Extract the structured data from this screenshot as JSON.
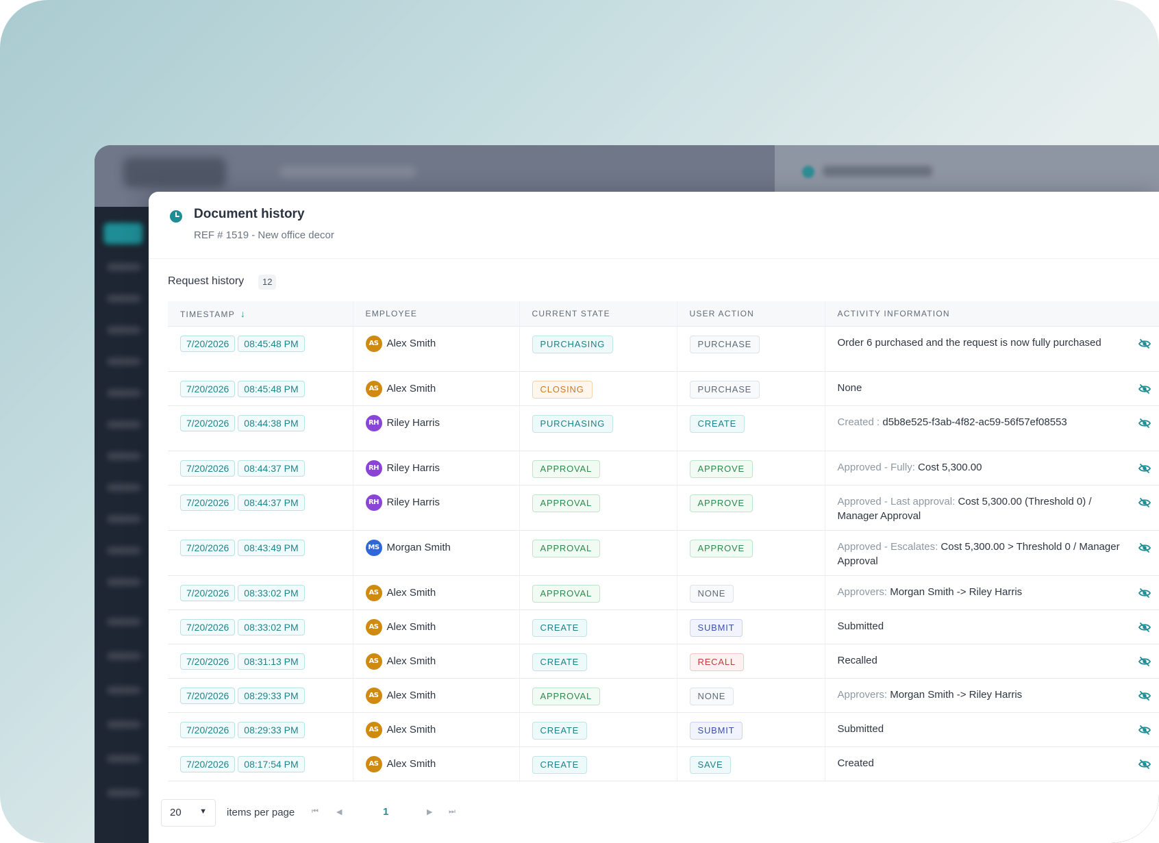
{
  "header": {
    "title": "Document history",
    "subtitle": "REF # 1519 - New office decor"
  },
  "section": {
    "title": "Request history",
    "count": "12"
  },
  "columns": [
    "TIMESTAMP",
    "EMPLOYEE",
    "CURRENT STATE",
    "USER ACTION",
    "ACTIVITY INFORMATION"
  ],
  "rows": [
    {
      "date": "7/20/2026",
      "time": "08:45:48 PM",
      "initials": "AS",
      "avatar_color": "#cf8a12",
      "employee": "Alex Smith",
      "state": "PURCHASING",
      "state_style": "teal",
      "action": "PURCHASE",
      "action_style": "gray",
      "info_muted": "",
      "info": "Order 6 purchased and the request is now fully purchased"
    },
    {
      "date": "7/20/2026",
      "time": "08:45:48 PM",
      "initials": "AS",
      "avatar_color": "#cf8a12",
      "employee": "Alex Smith",
      "state": "CLOSING",
      "state_style": "orange",
      "action": "PURCHASE",
      "action_style": "gray",
      "info_muted": "",
      "info": "None"
    },
    {
      "date": "7/20/2026",
      "time": "08:44:38 PM",
      "initials": "RH",
      "avatar_color": "#8a44d6",
      "employee": "Riley Harris",
      "state": "PURCHASING",
      "state_style": "teal",
      "action": "CREATE",
      "action_style": "teal",
      "info_muted": "Created : ",
      "info": "d5b8e525-f3ab-4f82-ac59-56f57ef08553"
    },
    {
      "date": "7/20/2026",
      "time": "08:44:37 PM",
      "initials": "RH",
      "avatar_color": "#8a44d6",
      "employee": "Riley Harris",
      "state": "APPROVAL",
      "state_style": "green",
      "action": "APPROVE",
      "action_style": "green",
      "info_muted": "Approved - Fully: ",
      "info": "Cost 5,300.00"
    },
    {
      "date": "7/20/2026",
      "time": "08:44:37 PM",
      "initials": "RH",
      "avatar_color": "#8a44d6",
      "employee": "Riley Harris",
      "state": "APPROVAL",
      "state_style": "green",
      "action": "APPROVE",
      "action_style": "green",
      "info_muted": "Approved - Last approval: ",
      "info": "Cost 5,300.00 (Threshold 0) / Manager Approval"
    },
    {
      "date": "7/20/2026",
      "time": "08:43:49 PM",
      "initials": "MS",
      "avatar_color": "#2f67d8",
      "employee": "Morgan Smith",
      "state": "APPROVAL",
      "state_style": "green",
      "action": "APPROVE",
      "action_style": "green",
      "info_muted": "Approved - Escalates: ",
      "info": "Cost 5,300.00 > Threshold 0 / Manager Approval"
    },
    {
      "date": "7/20/2026",
      "time": "08:33:02 PM",
      "initials": "AS",
      "avatar_color": "#cf8a12",
      "employee": "Alex Smith",
      "state": "APPROVAL",
      "state_style": "green",
      "action": "NONE",
      "action_style": "gray",
      "info_muted": "Approvers: ",
      "info": "Morgan Smith -> Riley Harris"
    },
    {
      "date": "7/20/2026",
      "time": "08:33:02 PM",
      "initials": "AS",
      "avatar_color": "#cf8a12",
      "employee": "Alex Smith",
      "state": "CREATE",
      "state_style": "teal",
      "action": "SUBMIT",
      "action_style": "blue",
      "info_muted": "",
      "info": "Submitted"
    },
    {
      "date": "7/20/2026",
      "time": "08:31:13 PM",
      "initials": "AS",
      "avatar_color": "#cf8a12",
      "employee": "Alex Smith",
      "state": "CREATE",
      "state_style": "teal",
      "action": "RECALL",
      "action_style": "red",
      "info_muted": "",
      "info": "Recalled"
    },
    {
      "date": "7/20/2026",
      "time": "08:29:33 PM",
      "initials": "AS",
      "avatar_color": "#cf8a12",
      "employee": "Alex Smith",
      "state": "APPROVAL",
      "state_style": "green",
      "action": "NONE",
      "action_style": "gray",
      "info_muted": "Approvers: ",
      "info": "Morgan Smith -> Riley Harris"
    },
    {
      "date": "7/20/2026",
      "time": "08:29:33 PM",
      "initials": "AS",
      "avatar_color": "#cf8a12",
      "employee": "Alex Smith",
      "state": "CREATE",
      "state_style": "teal",
      "action": "SUBMIT",
      "action_style": "blue",
      "info_muted": "",
      "info": "Submitted"
    },
    {
      "date": "7/20/2026",
      "time": "08:17:54 PM",
      "initials": "AS",
      "avatar_color": "#cf8a12",
      "employee": "Alex Smith",
      "state": "CREATE",
      "state_style": "teal",
      "action": "SAVE",
      "action_style": "teal",
      "info_muted": "",
      "info": "Created"
    }
  ],
  "pager": {
    "page_size": "20",
    "items_per_page_label": "items per page",
    "current_page": "1"
  },
  "icons": {
    "header": "clock-icon",
    "row_action": "eye-off-icon",
    "sort": "arrow-down-icon"
  },
  "colors": {
    "accent": "#2d8c94"
  }
}
